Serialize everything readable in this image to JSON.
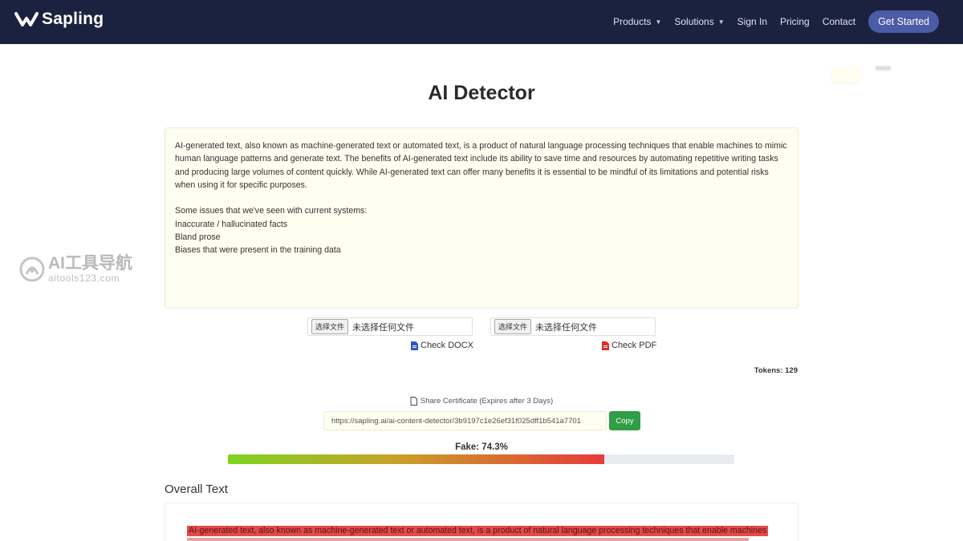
{
  "navbar": {
    "brand": "Sapling",
    "items": [
      {
        "label": "Products",
        "has_dropdown": true
      },
      {
        "label": "Solutions",
        "has_dropdown": true
      },
      {
        "label": "Sign In",
        "has_dropdown": false
      },
      {
        "label": "Pricing",
        "has_dropdown": false
      },
      {
        "label": "Contact",
        "has_dropdown": false
      }
    ],
    "cta": "Get Started",
    "caret_glyph": "▼"
  },
  "page": {
    "title": "AI Detector"
  },
  "input_text": {
    "paragraph1": "AI-generated text, also known as machine-generated text or automated text, is a product of natural language processing techniques that enable machines to mimic human language patterns and generate text. The benefits of AI-generated text include its ability to save time and resources by automating repetitive writing tasks and producing large volumes of content quickly. While AI-generated text can offer many benefits it is essential to be mindful of its limitations and potential risks when using it for specific purposes.",
    "list_intro": "Some issues that we've seen with current systems:",
    "list_items": [
      "Inaccurate / hallucinated facts",
      "Bland prose",
      "Biases that were present in the training data"
    ]
  },
  "watermark": {
    "title": "AI工具导航",
    "subtitle": "aitools123.com"
  },
  "file_inputs": {
    "docx": {
      "button": "选择文件",
      "status": "未选择任何文件",
      "check_label": "Check DOCX"
    },
    "pdf": {
      "button": "选择文件",
      "status": "未选择任何文件",
      "check_label": "Check PDF"
    }
  },
  "tokens": "Tokens: 129",
  "share": {
    "label": "Share Certificate (Expires after 3 Days)",
    "url": "https://sapling.ai/ai-content-detector/3b9197c1e26ef31f025dff1b541a7701",
    "copy_label": "Copy"
  },
  "score": {
    "label": "Fake: 74.3%",
    "fake_percent": 74.3
  },
  "overall": {
    "title": "Overall Text",
    "highlighted_line": "AI-generated text, also known as machine-generated text or automated text, is a product of natural language processing techniques that enable machines"
  },
  "colors": {
    "nav_bg": "#1b2240",
    "cta_bg": "#4b5ba6",
    "copy_bg": "#2f9e44",
    "highlight": "#e34a4a",
    "input_bg": "#fefef0"
  }
}
